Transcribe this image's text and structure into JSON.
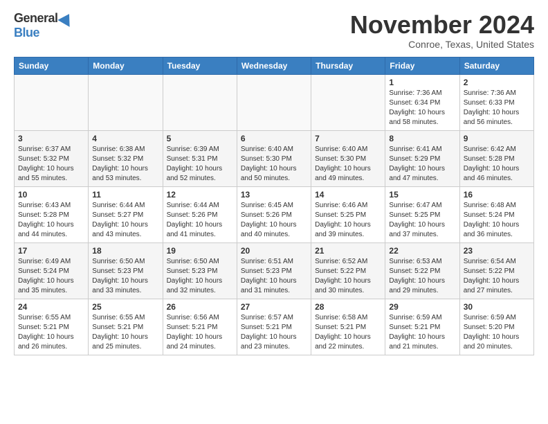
{
  "header": {
    "logo_general": "General",
    "logo_blue": "Blue",
    "main_title": "November 2024",
    "sub_title": "Conroe, Texas, United States"
  },
  "calendar": {
    "days_of_week": [
      "Sunday",
      "Monday",
      "Tuesday",
      "Wednesday",
      "Thursday",
      "Friday",
      "Saturday"
    ],
    "weeks": [
      [
        {
          "day": "",
          "info": ""
        },
        {
          "day": "",
          "info": ""
        },
        {
          "day": "",
          "info": ""
        },
        {
          "day": "",
          "info": ""
        },
        {
          "day": "",
          "info": ""
        },
        {
          "day": "1",
          "info": "Sunrise: 7:36 AM\nSunset: 6:34 PM\nDaylight: 10 hours and 58 minutes."
        },
        {
          "day": "2",
          "info": "Sunrise: 7:36 AM\nSunset: 6:33 PM\nDaylight: 10 hours and 56 minutes."
        }
      ],
      [
        {
          "day": "3",
          "info": "Sunrise: 6:37 AM\nSunset: 5:32 PM\nDaylight: 10 hours and 55 minutes."
        },
        {
          "day": "4",
          "info": "Sunrise: 6:38 AM\nSunset: 5:32 PM\nDaylight: 10 hours and 53 minutes."
        },
        {
          "day": "5",
          "info": "Sunrise: 6:39 AM\nSunset: 5:31 PM\nDaylight: 10 hours and 52 minutes."
        },
        {
          "day": "6",
          "info": "Sunrise: 6:40 AM\nSunset: 5:30 PM\nDaylight: 10 hours and 50 minutes."
        },
        {
          "day": "7",
          "info": "Sunrise: 6:40 AM\nSunset: 5:30 PM\nDaylight: 10 hours and 49 minutes."
        },
        {
          "day": "8",
          "info": "Sunrise: 6:41 AM\nSunset: 5:29 PM\nDaylight: 10 hours and 47 minutes."
        },
        {
          "day": "9",
          "info": "Sunrise: 6:42 AM\nSunset: 5:28 PM\nDaylight: 10 hours and 46 minutes."
        }
      ],
      [
        {
          "day": "10",
          "info": "Sunrise: 6:43 AM\nSunset: 5:28 PM\nDaylight: 10 hours and 44 minutes."
        },
        {
          "day": "11",
          "info": "Sunrise: 6:44 AM\nSunset: 5:27 PM\nDaylight: 10 hours and 43 minutes."
        },
        {
          "day": "12",
          "info": "Sunrise: 6:44 AM\nSunset: 5:26 PM\nDaylight: 10 hours and 41 minutes."
        },
        {
          "day": "13",
          "info": "Sunrise: 6:45 AM\nSunset: 5:26 PM\nDaylight: 10 hours and 40 minutes."
        },
        {
          "day": "14",
          "info": "Sunrise: 6:46 AM\nSunset: 5:25 PM\nDaylight: 10 hours and 39 minutes."
        },
        {
          "day": "15",
          "info": "Sunrise: 6:47 AM\nSunset: 5:25 PM\nDaylight: 10 hours and 37 minutes."
        },
        {
          "day": "16",
          "info": "Sunrise: 6:48 AM\nSunset: 5:24 PM\nDaylight: 10 hours and 36 minutes."
        }
      ],
      [
        {
          "day": "17",
          "info": "Sunrise: 6:49 AM\nSunset: 5:24 PM\nDaylight: 10 hours and 35 minutes."
        },
        {
          "day": "18",
          "info": "Sunrise: 6:50 AM\nSunset: 5:23 PM\nDaylight: 10 hours and 33 minutes."
        },
        {
          "day": "19",
          "info": "Sunrise: 6:50 AM\nSunset: 5:23 PM\nDaylight: 10 hours and 32 minutes."
        },
        {
          "day": "20",
          "info": "Sunrise: 6:51 AM\nSunset: 5:23 PM\nDaylight: 10 hours and 31 minutes."
        },
        {
          "day": "21",
          "info": "Sunrise: 6:52 AM\nSunset: 5:22 PM\nDaylight: 10 hours and 30 minutes."
        },
        {
          "day": "22",
          "info": "Sunrise: 6:53 AM\nSunset: 5:22 PM\nDaylight: 10 hours and 29 minutes."
        },
        {
          "day": "23",
          "info": "Sunrise: 6:54 AM\nSunset: 5:22 PM\nDaylight: 10 hours and 27 minutes."
        }
      ],
      [
        {
          "day": "24",
          "info": "Sunrise: 6:55 AM\nSunset: 5:21 PM\nDaylight: 10 hours and 26 minutes."
        },
        {
          "day": "25",
          "info": "Sunrise: 6:55 AM\nSunset: 5:21 PM\nDaylight: 10 hours and 25 minutes."
        },
        {
          "day": "26",
          "info": "Sunrise: 6:56 AM\nSunset: 5:21 PM\nDaylight: 10 hours and 24 minutes."
        },
        {
          "day": "27",
          "info": "Sunrise: 6:57 AM\nSunset: 5:21 PM\nDaylight: 10 hours and 23 minutes."
        },
        {
          "day": "28",
          "info": "Sunrise: 6:58 AM\nSunset: 5:21 PM\nDaylight: 10 hours and 22 minutes."
        },
        {
          "day": "29",
          "info": "Sunrise: 6:59 AM\nSunset: 5:21 PM\nDaylight: 10 hours and 21 minutes."
        },
        {
          "day": "30",
          "info": "Sunrise: 6:59 AM\nSunset: 5:20 PM\nDaylight: 10 hours and 20 minutes."
        }
      ]
    ]
  }
}
